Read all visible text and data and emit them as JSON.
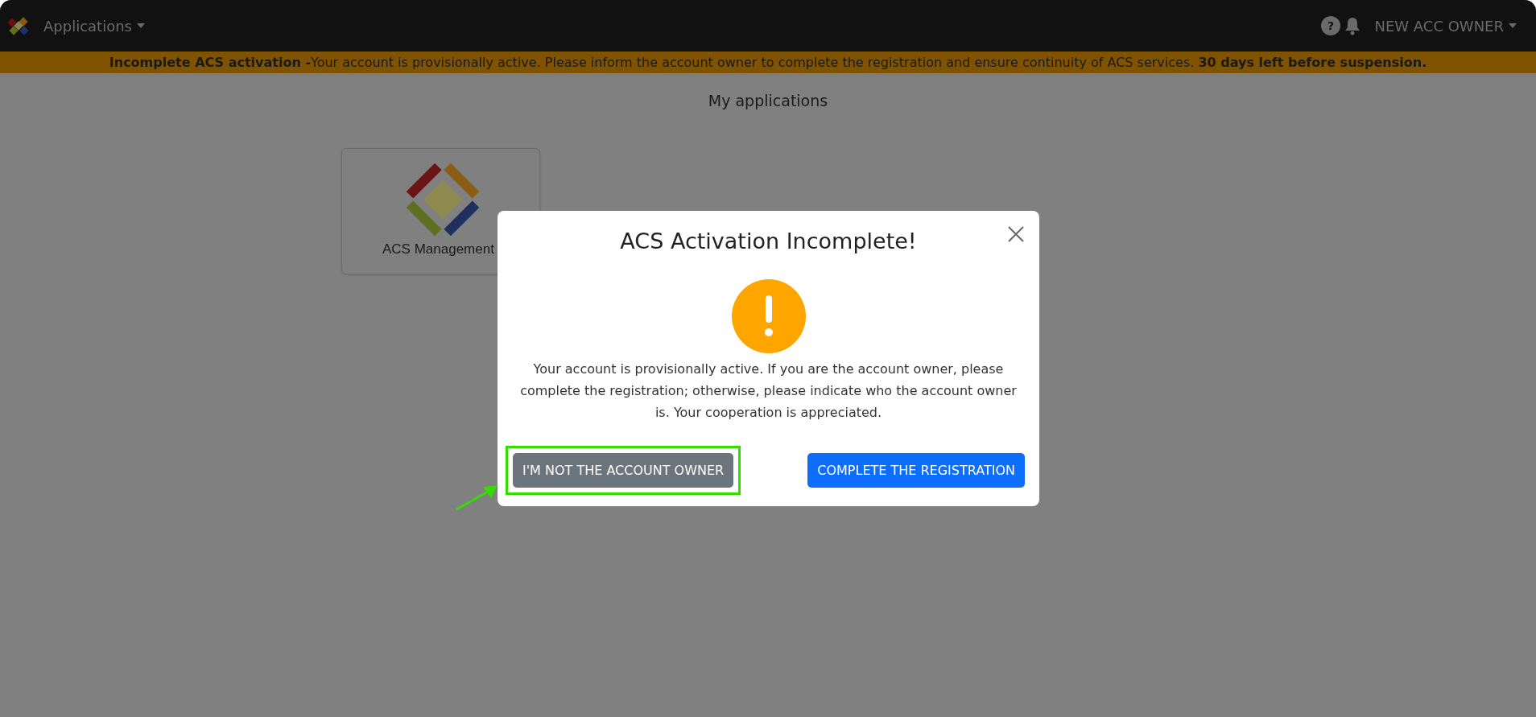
{
  "topbar": {
    "menu": {
      "label": "Applications"
    },
    "help": {
      "label": "?"
    },
    "user": {
      "label": "NEW ACC OWNER"
    }
  },
  "banner": {
    "text": "**Incomplete ACS activation -**Your account is provisionally active. Please inform the account owner to complete the registration and ensure continuity of ACS services. **30 days left before suspension.**"
  },
  "page_title": "My applications",
  "applications": [
    {
      "name": "ACS Management"
    }
  ],
  "dialog": {
    "title": "ACS Activation Incomplete!",
    "message": "Your account is provisionally active. If you are the account owner, please complete the registration; otherwise, please indicate who the account owner is. Your cooperation is appreciated.",
    "buttons": [
      {
        "label": "I'M NOT THE ACCOUNT OWNER",
        "kind": "secondary",
        "highlighted": true
      },
      {
        "label": "COMPLETE THE REGISTRATION",
        "kind": "primary",
        "highlighted": false
      }
    ]
  }
}
